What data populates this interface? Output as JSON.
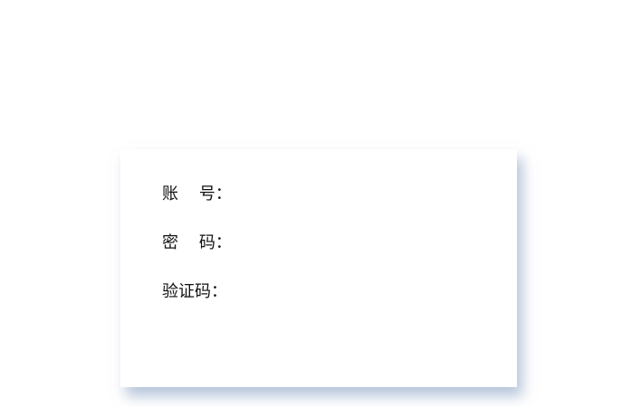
{
  "login_form": {
    "account": {
      "label": "账    号：",
      "value": "",
      "placeholder": ""
    },
    "password": {
      "label": "密    码：",
      "value": "",
      "placeholder": ""
    },
    "captcha": {
      "label": "验证码：",
      "value": "",
      "placeholder": ""
    }
  },
  "colors": {
    "background": "#ffffff",
    "card": "#ffffff",
    "shadow": "#c5d3e2",
    "text": "#111111"
  }
}
